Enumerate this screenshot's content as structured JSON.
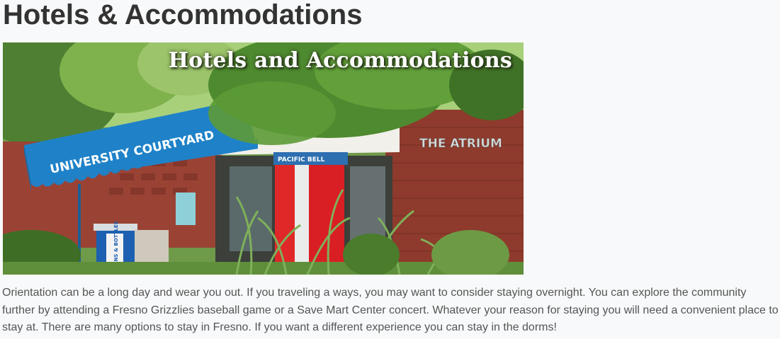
{
  "page": {
    "title": "Hotels & Accommodations"
  },
  "hero": {
    "overlay_title": "Hotels and Accommodations",
    "sign_text": "UNIVERSITY COURTYARD",
    "building_sign": "THE ATRIUM",
    "phone_sign": "PACIFIC BELL",
    "bin_label": "CANS & BOTTLES"
  },
  "intro": {
    "text": "Orientation can be a long day and wear you out. If you traveling a ways, you may want to consider staying overnight. You can explore the community further by attending a Fresno Grizzlies baseball game or a Save Mart Center concert. Whatever your reason for staying you will need a convenient place to stay at. There are many options to stay in Fresno. If you want a different experience you can stay in the dorms!"
  },
  "colors": {
    "heading": "#333333",
    "body_text": "#555555",
    "background": "#f8f9fa",
    "awning_blue": "#1f82c8",
    "brick": "#8e3a2c"
  }
}
